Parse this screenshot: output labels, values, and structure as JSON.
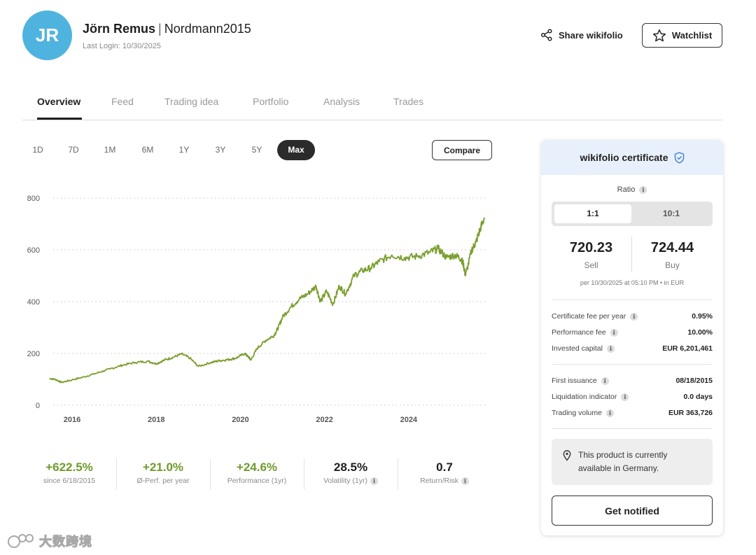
{
  "header": {
    "avatar_initials": "JR",
    "avatar_color": "#4fb3e0",
    "name": "Jörn Remus",
    "separator": "|",
    "handle": "Nordmann2015",
    "last_login": "Last Login: 10/30/2025",
    "share_label": "Share wikifolio",
    "watchlist_label": "Watchlist"
  },
  "tabs": [
    {
      "label": "Overview",
      "active": true
    },
    {
      "label": "Feed",
      "active": false
    },
    {
      "label": "Trading idea",
      "active": false
    },
    {
      "label": "Portfolio",
      "active": false
    },
    {
      "label": "Analysis",
      "active": false
    },
    {
      "label": "Trades",
      "active": false
    }
  ],
  "ranges": [
    {
      "label": "1D",
      "active": false
    },
    {
      "label": "7D",
      "active": false
    },
    {
      "label": "1M",
      "active": false
    },
    {
      "label": "6M",
      "active": false
    },
    {
      "label": "1Y",
      "active": false
    },
    {
      "label": "3Y",
      "active": false
    },
    {
      "label": "5Y",
      "active": false
    },
    {
      "label": "Max",
      "active": true
    }
  ],
  "compare_label": "Compare",
  "chart_data": {
    "type": "line",
    "title": "",
    "xlabel": "",
    "ylabel": "",
    "line_color": "#7a9e2e",
    "grid": "dotted horizontal",
    "ylim": [
      0,
      800
    ],
    "xlim": [
      2015.45,
      2025.85
    ],
    "y_ticks": [
      "0",
      "200",
      "400",
      "600",
      "800"
    ],
    "x_ticks": [
      "2016",
      "2018",
      "2020",
      "2022",
      "2024"
    ],
    "x": [
      2015.46,
      2015.6,
      2015.75,
      2016.0,
      2016.3,
      2016.6,
      2016.9,
      2017.2,
      2017.5,
      2017.8,
      2018.0,
      2018.2,
      2018.4,
      2018.6,
      2018.8,
      2019.0,
      2019.3,
      2019.5,
      2019.7,
      2019.9,
      2020.1,
      2020.2,
      2020.25,
      2020.4,
      2020.6,
      2020.8,
      2020.9,
      2021.0,
      2021.2,
      2021.4,
      2021.6,
      2021.8,
      2021.9,
      2022.05,
      2022.2,
      2022.35,
      2022.5,
      2022.7,
      2022.9,
      2023.1,
      2023.3,
      2023.6,
      2023.9,
      2024.2,
      2024.5,
      2024.7,
      2024.9,
      2025.1,
      2025.25,
      2025.3,
      2025.35,
      2025.5,
      2025.6,
      2025.7,
      2025.8
    ],
    "values": [
      103,
      100,
      88,
      98,
      110,
      125,
      140,
      155,
      165,
      170,
      160,
      175,
      185,
      198,
      182,
      150,
      165,
      172,
      176,
      182,
      200,
      185,
      175,
      220,
      250,
      270,
      300,
      340,
      380,
      410,
      430,
      460,
      400,
      440,
      390,
      460,
      430,
      500,
      520,
      530,
      555,
      580,
      570,
      575,
      590,
      605,
      570,
      580,
      565,
      545,
      500,
      600,
      630,
      680,
      725
    ]
  },
  "stats": [
    {
      "value": "+622.5%",
      "label": "since 6/18/2015",
      "positive": true,
      "info": false
    },
    {
      "value": "+21.0%",
      "label": "Ø-Perf. per year",
      "positive": true,
      "info": false
    },
    {
      "value": "+24.6%",
      "label": "Performance (1yr)",
      "positive": true,
      "info": false
    },
    {
      "value": "28.5%",
      "label": "Volatility (1yr)",
      "positive": false,
      "info": true
    },
    {
      "value": "0.7",
      "label": "Return/Risk",
      "positive": false,
      "info": true
    }
  ],
  "certificate": {
    "title": "wikifolio certificate",
    "ratio_label": "Ratio",
    "ratio_options": [
      {
        "label": "1:1",
        "active": true
      },
      {
        "label": "10:1",
        "active": false
      }
    ],
    "sell_value": "720.23",
    "sell_label": "Sell",
    "buy_value": "724.44",
    "buy_label": "Buy",
    "per_date": "per 10/30/2025 at 05:10 PM • in EUR",
    "fees": [
      {
        "key": "Certificate fee per year",
        "value": "0.95%"
      },
      {
        "key": "Performance fee",
        "value": "10.00%"
      },
      {
        "key": "Invested capital",
        "value": "EUR 6,201,461"
      }
    ],
    "details": [
      {
        "key": "First issuance",
        "value": "08/18/2015"
      },
      {
        "key": "Liquidation indicator",
        "value": "0.0 days"
      },
      {
        "key": "Trading volume",
        "value": "EUR 363,726"
      }
    ],
    "notice": "This product is currently available in Germany.",
    "notify_label": "Get notified"
  },
  "watermark": "大数跨境"
}
